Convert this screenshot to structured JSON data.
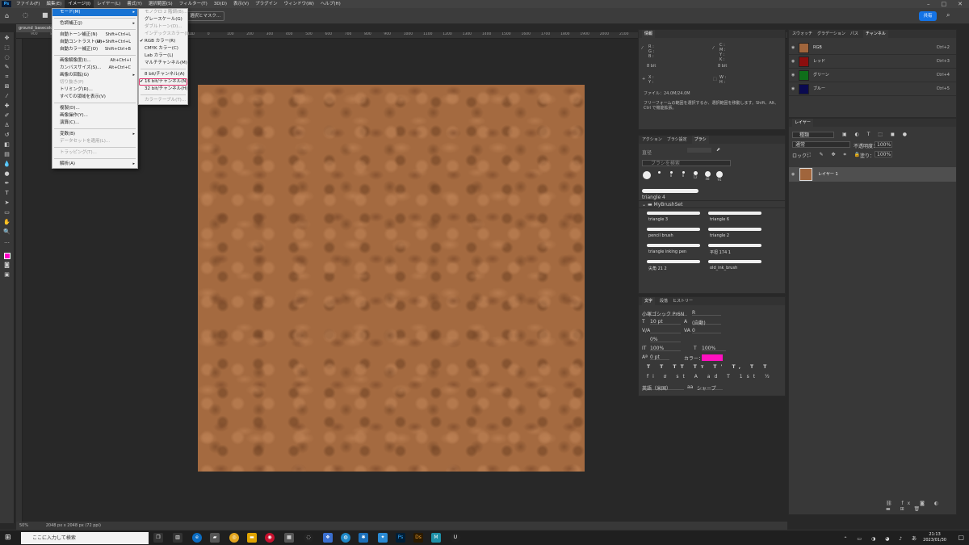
{
  "menubar": {
    "items": [
      "ファイル(F)",
      "編集(E)",
      "イメージ(I)",
      "レイヤー(L)",
      "書式(Y)",
      "選択範囲(S)",
      "フィルター(T)",
      "3D(D)",
      "表示(V)",
      "プラグイン",
      "ウィンドウ(W)",
      "ヘルプ(H)"
    ],
    "active_index": 2,
    "logo": "Ps"
  },
  "optbar": {
    "mask_label": "選択とマスク...",
    "share_label": "共有"
  },
  "document": {
    "tab_title": "ground_basecolor",
    "zoom": "50%",
    "size": "2048 px x 2048 px (72 ppi)"
  },
  "ruler": {
    "labels": [
      "900",
      "800",
      "700",
      "600",
      "500",
      "400",
      "300",
      "200",
      "100",
      "0",
      "100",
      "200",
      "300",
      "400",
      "500",
      "600",
      "700",
      "800",
      "900",
      "1000",
      "1100",
      "1200",
      "1300",
      "1400",
      "1500",
      "1600",
      "1700",
      "1800",
      "1900",
      "2000",
      "2100",
      "2200",
      "2300",
      "2400",
      "2500",
      "2600",
      "2700",
      "2800",
      "2900"
    ]
  },
  "image_menu": {
    "items": [
      {
        "label": "モード(M)",
        "arrow": true,
        "highlight": true
      },
      {
        "sep": true
      },
      {
        "label": "色調補正(J)",
        "arrow": true
      },
      {
        "sep": true
      },
      {
        "label": "自動トーン補正(N)",
        "shortcut": "Shift+Ctrl+L"
      },
      {
        "label": "自動コントラスト(U)",
        "shortcut": "Alt+Shift+Ctrl+L"
      },
      {
        "label": "自動カラー補正(O)",
        "shortcut": "Shift+Ctrl+B"
      },
      {
        "sep": true
      },
      {
        "label": "画像解像度(I)...",
        "shortcut": "Alt+Ctrl+I"
      },
      {
        "label": "カンバスサイズ(S)...",
        "shortcut": "Alt+Ctrl+C"
      },
      {
        "label": "画像の回転(G)",
        "arrow": true
      },
      {
        "label": "切り抜き(P)",
        "disabled": true
      },
      {
        "label": "トリミング(R)..."
      },
      {
        "label": "すべての領域を表示(V)"
      },
      {
        "sep": true
      },
      {
        "label": "複製(D)..."
      },
      {
        "label": "画像操作(Y)..."
      },
      {
        "label": "演算(C)..."
      },
      {
        "sep": true
      },
      {
        "label": "変数(B)",
        "arrow": true
      },
      {
        "label": "データセットを適用(L)...",
        "disabled": true
      },
      {
        "sep": true
      },
      {
        "label": "トラッピング(T)...",
        "disabled": true
      },
      {
        "sep": true
      },
      {
        "label": "解析(A)",
        "arrow": true
      }
    ]
  },
  "mode_menu": {
    "items": [
      {
        "label": "モノクロ 2 階調(B)...",
        "disabled": true
      },
      {
        "label": "グレースケール(G)"
      },
      {
        "label": "ダブルトーン(D)...",
        "disabled": true
      },
      {
        "label": "インデックスカラー(I)...",
        "disabled": true
      },
      {
        "label": "RGB カラー(R)",
        "checked": true
      },
      {
        "label": "CMYK カラー(C)"
      },
      {
        "label": "Lab カラー(L)"
      },
      {
        "label": "マルチチャンネル(M)"
      },
      {
        "sep": true
      },
      {
        "label": "8 bit/チャンネル(A)"
      },
      {
        "label": "16 bit/チャンネル(N)",
        "checked": true,
        "boxed": true
      },
      {
        "label": "32 bit/チャンネル(H)"
      },
      {
        "sep": true
      },
      {
        "label": "カラーテーブル(T)...",
        "disabled": true
      }
    ]
  },
  "info_panel": {
    "title": "情報",
    "rgb_labels": "R :\nG :\nB :",
    "cmyk_labels": "C :\nM :\nY :\nK :",
    "bit_left": "8 bit",
    "bit_right": "8 bit",
    "xy": "X :\nY :",
    "wh": "W :\nH :",
    "file": "ファイル：24.0M/24.0M",
    "hint": "フリーフォームの範囲を選択するか、選択範囲を移動します。Shift、Alt、Ctrl で機能拡張。"
  },
  "brush_panel": {
    "tabs": [
      "アクション",
      "ブラシ設定",
      "ブラシ"
    ],
    "size_label": "直径",
    "search_placeholder": "ブラシを検索",
    "preset_sizes": [
      "",
      "",
      "8",
      "8",
      "12",
      "48",
      "91"
    ],
    "top_brush": "triangle 4",
    "group_name": "MyBrushSet",
    "brushes": [
      [
        "triangle 3",
        "triangle 6"
      ],
      [
        "pencil brush",
        "triangle 2"
      ],
      [
        "triangle inking pen",
        "平坦 174 1"
      ],
      [
        "尖角 21 2",
        "old_ink_brush"
      ]
    ]
  },
  "char_panel": {
    "tabs": [
      "文字",
      "段落",
      "ヒストリー"
    ],
    "font": "小塚ゴシック Pr6N",
    "style": "R",
    "size": "10 pt",
    "leading": "(自動)",
    "tracking": "0",
    "scale_v": "100%",
    "scale_h": "100%",
    "baseline": "0 pt",
    "kerning": "0%",
    "color_label": "カラー：",
    "color": "#ff10c0",
    "language": "英語（米国）",
    "aa": "シャープ",
    "aa_label": "aa"
  },
  "channels_panel": {
    "tabs": [
      "スウォッチ",
      "グラデーション",
      "パス",
      "チャンネル"
    ],
    "channels": [
      {
        "name": "RGB",
        "shortcut": "Ctrl+2",
        "color": "#a0653c"
      },
      {
        "name": "レッド",
        "shortcut": "Ctrl+3",
        "color": "#8c0e0e"
      },
      {
        "name": "グリーン",
        "shortcut": "Ctrl+4",
        "color": "#0f6e1a"
      },
      {
        "name": "ブルー",
        "shortcut": "Ctrl+5",
        "color": "#0a0a50"
      }
    ]
  },
  "layers_panel": {
    "title": "レイヤー",
    "kind": "種類",
    "blend": "通常",
    "opacity_label": "不透明度：",
    "opacity": "100%",
    "lock_label": "ロック：",
    "fill_label": "塗り：",
    "fill": "100%",
    "layer_name": "レイヤー 1",
    "layer_color": "#a0653c"
  },
  "taskbar": {
    "search_placeholder": "ここに入力して検索",
    "time": "21:13",
    "date": "2023/01/30"
  },
  "colors": {
    "canvas": "#a46a40",
    "foreground": "#ff00c8",
    "accent": "#1473e6"
  }
}
